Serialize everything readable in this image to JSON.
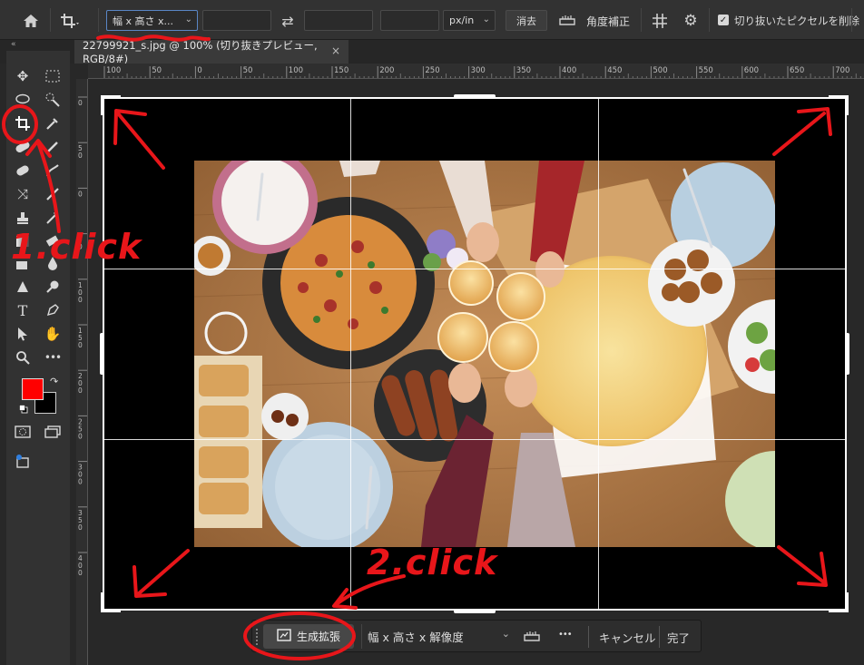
{
  "options_bar": {
    "ratio_preset": "幅 x 高さ x...",
    "width_value": "",
    "height_value": "",
    "resolution_value": "",
    "resolution_unit": "px/in",
    "clear_label": "消去",
    "straighten_label": "角度補正",
    "delete_cropped_label": "切り抜いたピクセルを削除",
    "delete_cropped_checked": true
  },
  "document_tab": {
    "title": "22799921_s.jpg @ 100% (切り抜きプレビュー, RGB/8#)",
    "close_glyph": "×"
  },
  "ruler_top_ticks": [
    "100",
    "50",
    "0",
    "50",
    "100",
    "150",
    "200",
    "250",
    "300",
    "350",
    "400",
    "450",
    "500",
    "550",
    "600",
    "650",
    "700"
  ],
  "ruler_left_ticks": [
    "0",
    "5\n0",
    "0",
    "5\n0",
    "1\n0\n0",
    "1\n5\n0",
    "2\n0\n0",
    "2\n5\n0",
    "3\n0\n0",
    "3\n5\n0",
    "4\n0\n0"
  ],
  "colors": {
    "foreground": "#ff0000",
    "background": "#000000",
    "annotation": "#e8161a"
  },
  "task_bar": {
    "generative_expand_label": "生成拡張",
    "ratio_preset": "幅 x 高さ x 解像度",
    "more_glyph": "•••",
    "cancel_label": "キャンセル",
    "done_label": "完了"
  },
  "annotations": {
    "step1": "1.click",
    "step2": "2.click"
  }
}
